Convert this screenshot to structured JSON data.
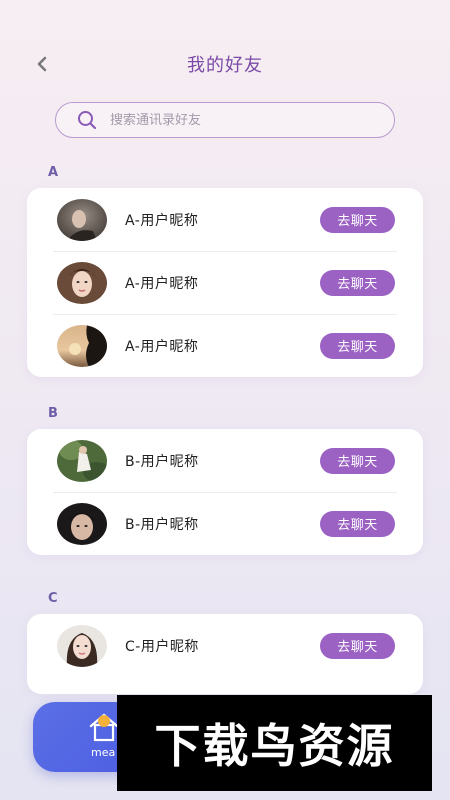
{
  "header": {
    "title": "我的好友"
  },
  "search": {
    "placeholder": "搜索通讯录好友"
  },
  "groups": [
    {
      "letter": "A",
      "friends": [
        {
          "name": "A-用户昵称",
          "button": "去聊天"
        },
        {
          "name": "A-用户昵称",
          "button": "去聊天"
        },
        {
          "name": "A-用户昵称",
          "button": "去聊天"
        }
      ]
    },
    {
      "letter": "B",
      "friends": [
        {
          "name": "B-用户昵称",
          "button": "去聊天"
        },
        {
          "name": "B-用户昵称",
          "button": "去聊天"
        }
      ]
    },
    {
      "letter": "C",
      "friends": [
        {
          "name": "C-用户昵称",
          "button": "去聊天"
        }
      ]
    }
  ],
  "bottom_nav": {
    "label": "mea"
  },
  "watermark": {
    "text": "下载鸟资源"
  },
  "colors": {
    "accent": "#9b62c4",
    "title": "#7a4aa6",
    "letter": "#6e5ea8",
    "nav": "#4f60e2"
  }
}
